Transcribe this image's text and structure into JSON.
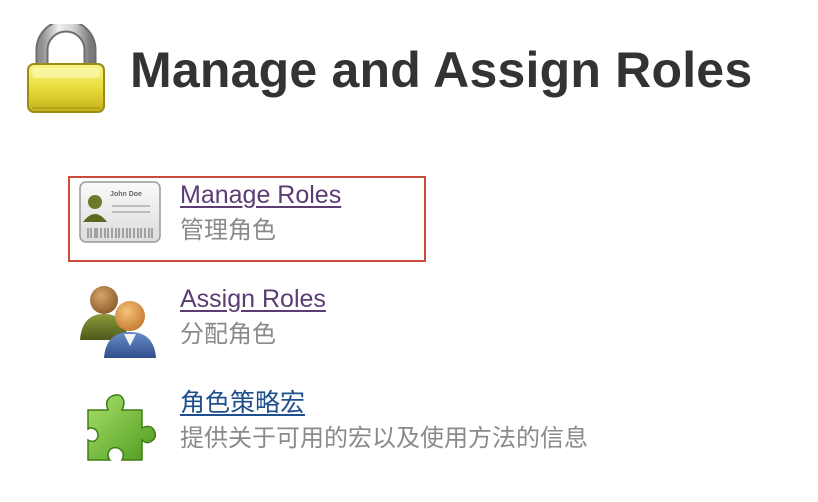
{
  "page": {
    "title": "Manage and Assign Roles",
    "title_icon": "lock-icon"
  },
  "items": [
    {
      "label": "Manage Roles",
      "description": "管理角色",
      "icon": "id-card-icon",
      "link_color": "#5b3d73",
      "highlighted": true
    },
    {
      "label": "Assign Roles",
      "description": "分配角色",
      "icon": "users-icon",
      "link_color": "#5b3d73"
    },
    {
      "label": "角色策略宏",
      "description": "提供关于可用的宏以及使用方法的信息",
      "icon": "puzzle-piece-icon",
      "link_color": "#1f4f8c"
    }
  ],
  "id_card": {
    "name": "John Doe"
  },
  "colors": {
    "highlight_border": "#cc4a3a",
    "title": "#333333",
    "description": "#8a8a8a"
  }
}
